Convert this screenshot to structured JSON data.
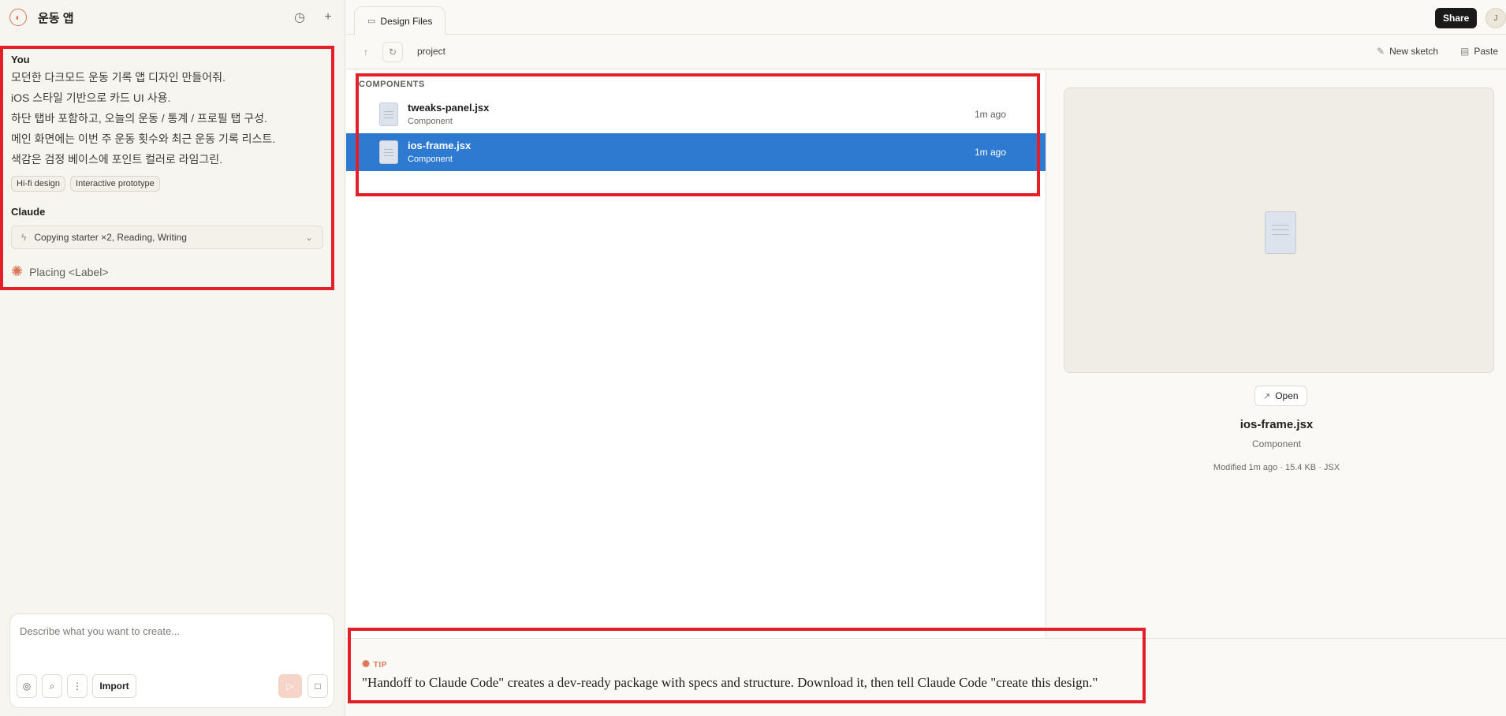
{
  "project": {
    "title": "운동 앱"
  },
  "chat": {
    "user_label": "You",
    "user_lines": [
      "모던한 다크모드 운동 기록 앱 디자인 만들어줘.",
      "iOS 스타일 기반으로 카드 UI 사용.",
      "하단 탭바 포함하고, 오늘의 운동 / 통계 / 프로필 탭 구성.",
      "메인 화면에는 이번 주 운동 횟수와 최근 운동 기록 리스트.",
      "색감은 검정 베이스에 포인트 컬러로 라임그린."
    ],
    "chips": [
      "Hi-fi design",
      "Interactive prototype"
    ],
    "assistant_label": "Claude",
    "activity": "Copying starter ×2, Reading, Writing",
    "status": "Placing <Label>"
  },
  "composer": {
    "placeholder": "Describe what you want to create...",
    "import_label": "Import"
  },
  "tabs": [
    {
      "label": "Design Files"
    }
  ],
  "header": {
    "share_label": "Share",
    "avatar_initial": "J"
  },
  "toolbar": {
    "breadcrumb": "project",
    "new_sketch": "New sketch",
    "paste": "Paste"
  },
  "files": {
    "section": "COMPONENTS",
    "items": [
      {
        "name": "tweaks-panel.jsx",
        "type": "Component",
        "time": "1m ago",
        "selected": false
      },
      {
        "name": "ios-frame.jsx",
        "type": "Component",
        "time": "1m ago",
        "selected": true
      }
    ]
  },
  "preview": {
    "open_label": "Open",
    "name": "ios-frame.jsx",
    "type": "Component",
    "meta": "Modified 1m ago · 15.4 KB · JSX"
  },
  "tip": {
    "label": "TIP",
    "text": "\"Handoff to Claude Code\" creates a dev-ready package with specs and structure. Download it, then tell Claude Code \"create this design.\""
  },
  "colors": {
    "accent": "#d97757",
    "selection": "#2e7ad1",
    "highlight": "#e3202a"
  }
}
